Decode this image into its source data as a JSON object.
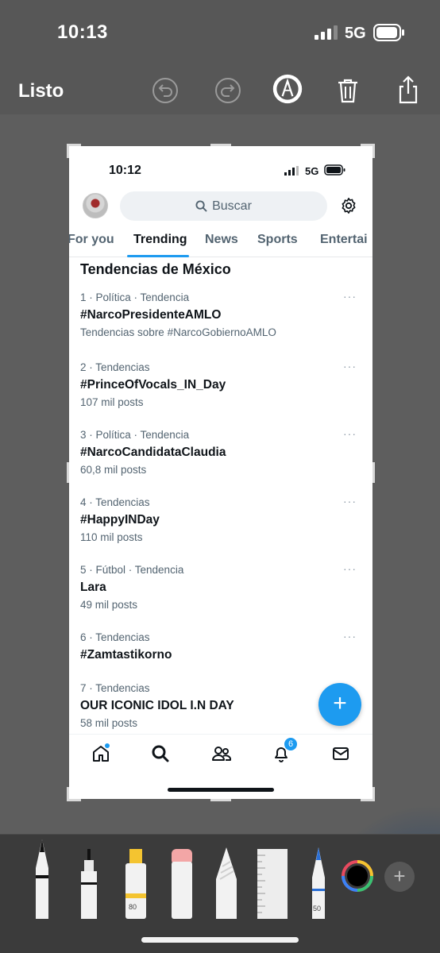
{
  "outer_status": {
    "time": "10:13",
    "network": "5G"
  },
  "markup_toolbar": {
    "done_label": "Listo",
    "icons": [
      "undo-icon",
      "redo-icon",
      "markup-pen-icon",
      "trash-icon",
      "share-icon"
    ]
  },
  "screenshot": {
    "status": {
      "time": "10:12",
      "network": "5G"
    },
    "search_placeholder": "Buscar",
    "tabs": [
      {
        "label": "For you",
        "active": false
      },
      {
        "label": "Trending",
        "active": true
      },
      {
        "label": "News",
        "active": false
      },
      {
        "label": "Sports",
        "active": false
      },
      {
        "label": "Entertai",
        "active": false
      }
    ],
    "section_title": "Tendencias de México",
    "trends": [
      {
        "meta": "1 · Política · Tendencia",
        "name": "#NarcoPresidenteAMLO",
        "sub": "Tendencias sobre #NarcoGobiernoAMLO"
      },
      {
        "meta": "2 · Tendencias",
        "name": "#PrinceOfVocals_IN_Day",
        "sub": "107 mil posts"
      },
      {
        "meta": "3 · Política · Tendencia",
        "name": "#NarcoCandidataClaudia",
        "sub": "60,8 mil posts"
      },
      {
        "meta": "4 · Tendencias",
        "name": "#HappyINDay",
        "sub": "110 mil posts"
      },
      {
        "meta": "5 · Fútbol · Tendencia",
        "name": "Lara",
        "sub": "49 mil posts"
      },
      {
        "meta": "6 · Tendencias",
        "name": "#Zamtastikorno",
        "sub": ""
      },
      {
        "meta": "7 · Tendencias",
        "name": "OUR ICONIC IDOL I.N DAY",
        "sub": "58 mil posts"
      }
    ],
    "more_label": "···",
    "fab_label": "+",
    "notifications_badge": "6",
    "nav_icons": [
      "home-icon",
      "search-icon",
      "communities-icon",
      "notifications-icon",
      "messages-icon"
    ]
  },
  "tools": {
    "highlighter_size": "80",
    "pen_size": "50",
    "add_label": "+",
    "colors": {
      "accent": "#1d9bf0",
      "text": "#0f1419",
      "muted": "#536471"
    }
  }
}
